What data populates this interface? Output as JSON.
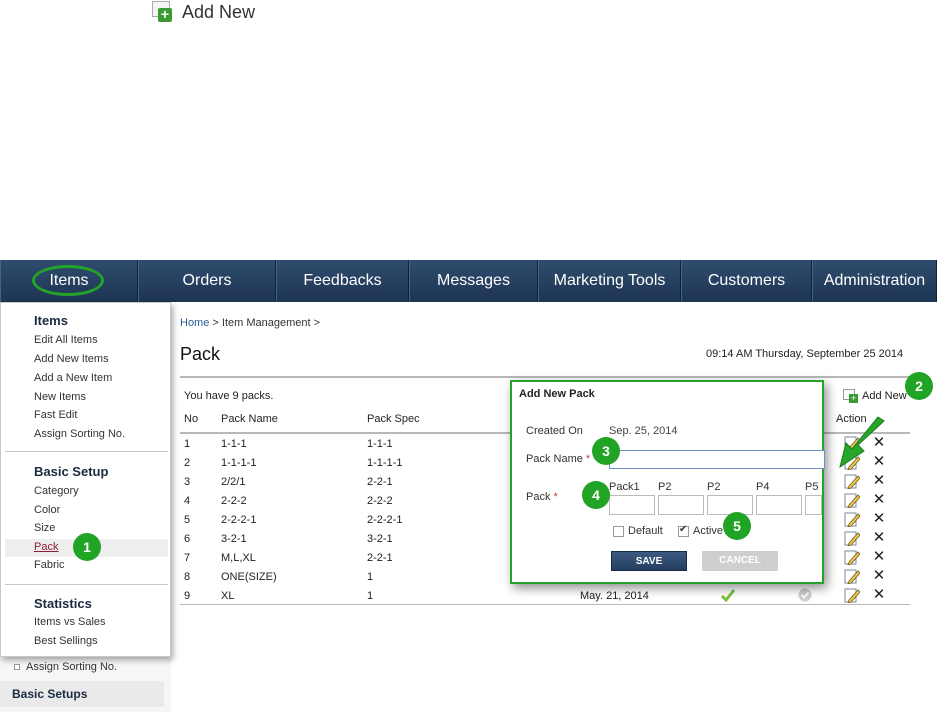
{
  "top_add": {
    "label": "Add New",
    "icon": "add-new-icon"
  },
  "nav": {
    "items": [
      "Items",
      "Orders",
      "Feedbacks",
      "Messages",
      "Marketing Tools",
      "Customers",
      "Administration"
    ]
  },
  "dropdown": {
    "items_title": "Items",
    "items_links": [
      "Edit All Items",
      "Add New Items",
      "Add a New Item",
      "New Items",
      "Fast Edit",
      "Assign Sorting No."
    ],
    "basic_title": "Basic Setup",
    "basic_links": [
      "Category",
      "Color",
      "Size",
      "Pack",
      "Fabric"
    ],
    "stats_title": "Statistics",
    "stats_links": [
      "Items vs Sales",
      "Best Sellings"
    ]
  },
  "sidebar_below": {
    "sorting": "Assign Sorting No.",
    "basic_setups": "Basic Setups"
  },
  "badges": [
    "1",
    "2",
    "3",
    "4",
    "5"
  ],
  "breadcrumb": {
    "home": "Home",
    "sep1": " > ",
    "item_mgmt": "Item Management",
    "sep2": " >"
  },
  "page": {
    "title": "Pack",
    "datetime": "09:14 AM Thursday, September 25 2014",
    "count_text": "You have 9 packs.",
    "add_new": "Add New"
  },
  "table": {
    "headers": {
      "no": "No",
      "name": "Pack Name",
      "spec": "Pack Spec",
      "action": "Action"
    },
    "rows": [
      {
        "no": "1",
        "name": "1-1-1",
        "spec": "1-1-1"
      },
      {
        "no": "2",
        "name": "1-1-1-1",
        "spec": "1-1-1-1"
      },
      {
        "no": "3",
        "name": "2/2/1",
        "spec": "2-2-1"
      },
      {
        "no": "4",
        "name": "2-2-2",
        "spec": "2-2-2"
      },
      {
        "no": "5",
        "name": "2-2-2-1",
        "spec": "2-2-2-1"
      },
      {
        "no": "6",
        "name": "3-2-1",
        "spec": "3-2-1"
      },
      {
        "no": "7",
        "name": "M,L,XL",
        "spec": "2-2-1"
      },
      {
        "no": "8",
        "name": "ONE(SIZE)",
        "spec": "1"
      },
      {
        "no": "9",
        "name": "XL",
        "spec": "1",
        "date": "May. 21, 2014"
      }
    ]
  },
  "modal": {
    "title": "Add New Pack",
    "created_label": "Created On",
    "created_value": "Sep. 25, 2014",
    "name_label": "Pack Name",
    "pack_label": "Pack",
    "required_mark": "*",
    "pack_columns": [
      "Pack1",
      "P2",
      "P2",
      "P4",
      "P5"
    ],
    "default_label": "Default",
    "active_label": "Active",
    "save_label": "SAVE",
    "cancel_label": "CANCEL"
  },
  "colors": {
    "nav_bg": "#243e5f",
    "accent_green": "#21a326",
    "link_blue": "#2a5d9c",
    "active_link": "#8b1c36"
  }
}
